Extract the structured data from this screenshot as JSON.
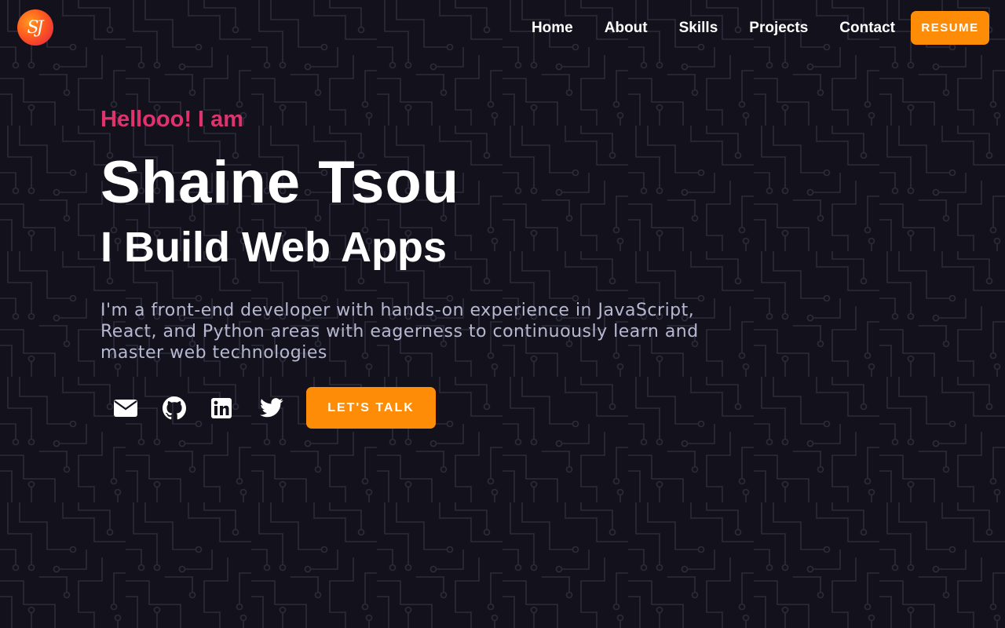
{
  "header": {
    "logo_text": "SJ",
    "nav": [
      {
        "label": "Home"
      },
      {
        "label": "About"
      },
      {
        "label": "Skills"
      },
      {
        "label": "Projects"
      },
      {
        "label": "Contact"
      }
    ],
    "resume_label": "RESUME"
  },
  "hero": {
    "greeting": "Hellooo! I am",
    "name": "Shaine Tsou",
    "tagline": "I Build Web Apps",
    "bio": "I'm a front-end developer with hands-on experience in JavaScript, React, and Python areas with eagerness to continuously learn and master web technologies",
    "social": [
      {
        "icon": "envelope-icon"
      },
      {
        "icon": "github-icon"
      },
      {
        "icon": "linkedin-icon"
      },
      {
        "icon": "twitter-icon"
      }
    ],
    "cta_label": "LET'S TALK"
  },
  "colors": {
    "background": "#13121c",
    "accent_orange": "#ff8c07",
    "greeting_pink": "#e0336e",
    "bio_text": "#b6b8d2",
    "circuit_lines": "#2c2b3a"
  }
}
